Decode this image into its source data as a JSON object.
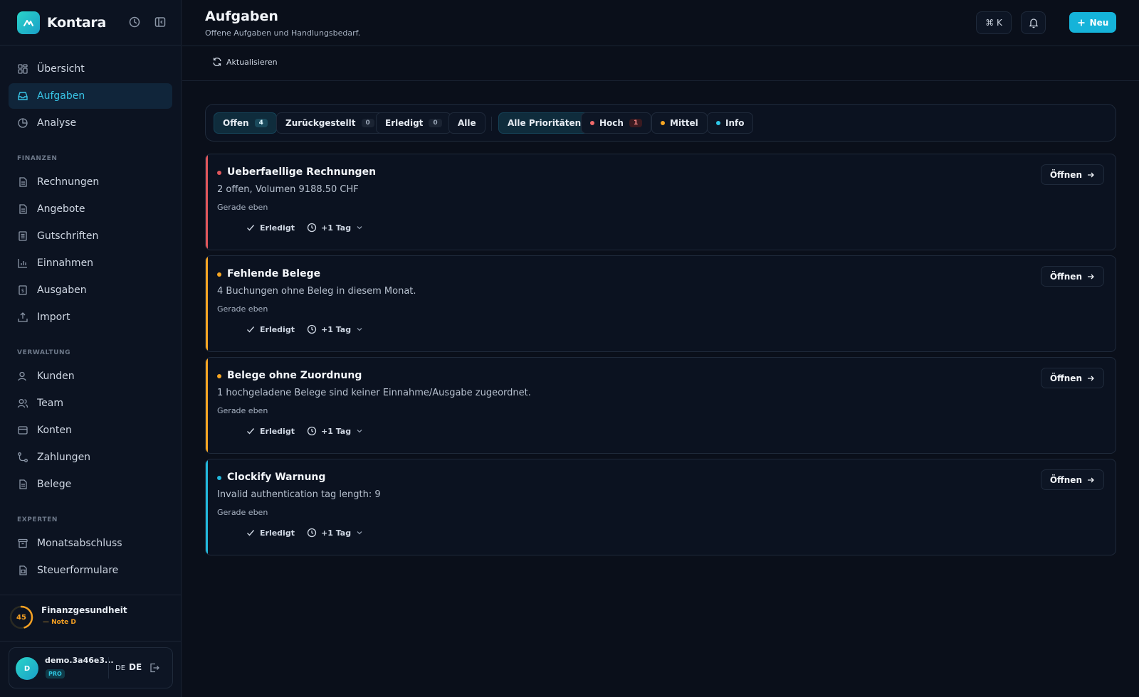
{
  "brand": {
    "name": "Kontara"
  },
  "sidebar": {
    "items_top": [
      {
        "label": "Übersicht",
        "icon": "grid-icon"
      },
      {
        "label": "Aufgaben",
        "icon": "inbox-icon",
        "active": true
      },
      {
        "label": "Analyse",
        "icon": "pie-chart-icon"
      }
    ],
    "section_finanzen": "FINANZEN",
    "items_finanzen": [
      {
        "label": "Rechnungen",
        "icon": "document-icon"
      },
      {
        "label": "Angebote",
        "icon": "document-icon"
      },
      {
        "label": "Gutschriften",
        "icon": "document-list-icon"
      },
      {
        "label": "Einnahmen",
        "icon": "bar-chart-icon"
      },
      {
        "label": "Ausgaben",
        "icon": "receipt-icon"
      },
      {
        "label": "Import",
        "icon": "upload-icon"
      }
    ],
    "section_verwaltung": "VERWALTUNG",
    "items_verwaltung": [
      {
        "label": "Kunden",
        "icon": "user-icon"
      },
      {
        "label": "Team",
        "icon": "users-icon"
      },
      {
        "label": "Konten",
        "icon": "wallet-icon"
      },
      {
        "label": "Zahlungen",
        "icon": "route-icon"
      },
      {
        "label": "Belege",
        "icon": "file-icon"
      }
    ],
    "section_experten": "EXPERTEN",
    "items_experten": [
      {
        "label": "Monatsabschluss",
        "icon": "archive-icon"
      },
      {
        "label": "Steuerformulare",
        "icon": "form-icon"
      }
    ],
    "health": {
      "title": "Finanzgesundheit",
      "score": "45",
      "score_fraction": 0.45,
      "grade": "Note D"
    },
    "user": {
      "avatar": "D",
      "name": "demo.3a46e3...",
      "plan": "PRO",
      "lang_small": "DE",
      "lang": "DE"
    }
  },
  "header": {
    "title": "Aufgaben",
    "subtitle": "Offene Aufgaben und Handlungsbedarf.",
    "shortcut": "⌘ K",
    "new_label": "Neu",
    "refresh_label": "Aktualisieren"
  },
  "filters": {
    "status": [
      {
        "label": "Offen",
        "count": "4",
        "active": true
      },
      {
        "label": "Zurückgestellt",
        "count": "0"
      },
      {
        "label": "Erledigt",
        "count": "0"
      },
      {
        "label": "Alle"
      }
    ],
    "priority": [
      {
        "label": "Alle Prioritäten",
        "active": true
      },
      {
        "label": "Hoch",
        "count": "1",
        "color": "#f06a6a"
      },
      {
        "label": "Mittel",
        "color": "#f6a623"
      },
      {
        "label": "Info",
        "color": "#2ec6e6"
      }
    ]
  },
  "tasks": [
    {
      "title": "Ueberfaellige Rechnungen",
      "description": "2 offen, Volumen 9188.50 CHF",
      "time": "Gerade eben",
      "color": "#e0565b",
      "done_label": "Erledigt",
      "snooze_label": "+1 Tag",
      "open_label": "Öffnen"
    },
    {
      "title": "Fehlende Belege",
      "description": "4 Buchungen ohne Beleg in diesem Monat.",
      "time": "Gerade eben",
      "color": "#f6a623",
      "done_label": "Erledigt",
      "snooze_label": "+1 Tag",
      "open_label": "Öffnen"
    },
    {
      "title": "Belege ohne Zuordnung",
      "description": "1 hochgeladene Belege sind keiner Einnahme/Ausgabe zugeordnet.",
      "time": "Gerade eben",
      "color": "#f6a623",
      "done_label": "Erledigt",
      "snooze_label": "+1 Tag",
      "open_label": "Öffnen"
    },
    {
      "title": "Clockify Warnung",
      "description": "Invalid authentication tag length: 9",
      "time": "Gerade eben",
      "color": "#22b8dc",
      "done_label": "Erledigt",
      "snooze_label": "+1 Tag",
      "open_label": "Öffnen"
    }
  ],
  "colors": {
    "accent": "#15b3d9",
    "background": "#0a0f1a",
    "sidebar": "#0c1321"
  }
}
